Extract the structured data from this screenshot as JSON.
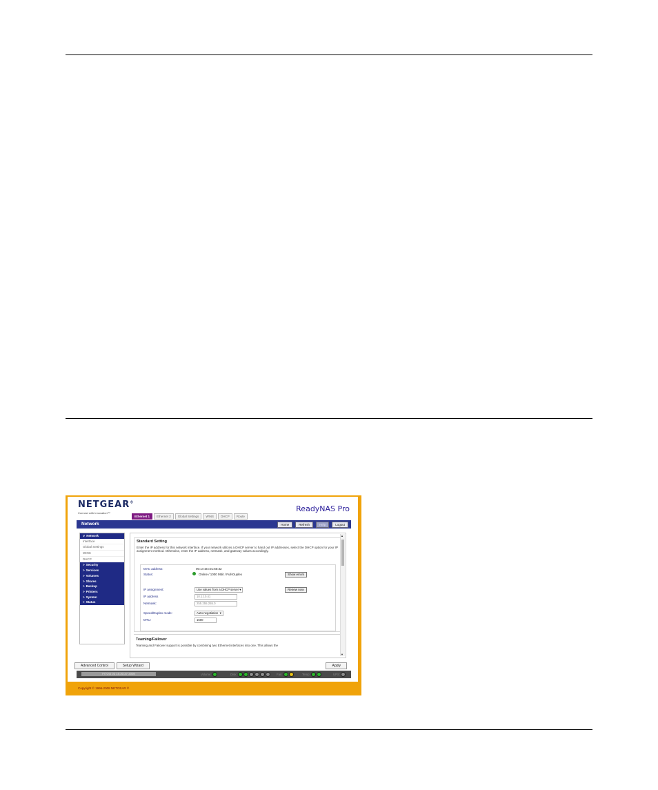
{
  "brand": {
    "logo": "NETGEAR",
    "reg": "®",
    "tagline": "Connect with Innovation™",
    "product": "ReadyNAS Pro",
    "accent": "#2b3791",
    "frame": "#f0a30a"
  },
  "tabs": [
    "Ethernet 1",
    "Ethernet 2",
    "Global Settings",
    "WINS",
    "DHCP",
    "Route"
  ],
  "header": {
    "section": "Network",
    "buttons": [
      "Home",
      "Refresh",
      "Help",
      "Logout"
    ]
  },
  "sidebar": [
    {
      "label": "Network",
      "kind": "head",
      "caret": "∨"
    },
    {
      "label": "Interface",
      "kind": "sub"
    },
    {
      "label": "Global Settings",
      "kind": "sub"
    },
    {
      "label": "WINS",
      "kind": "sub"
    },
    {
      "label": "DHCP",
      "kind": "sub"
    },
    {
      "label": "Security",
      "kind": "head",
      "caret": ">"
    },
    {
      "label": "Services",
      "kind": "head",
      "caret": ">"
    },
    {
      "label": "Volumes",
      "kind": "head",
      "caret": ">"
    },
    {
      "label": "Shares",
      "kind": "head",
      "caret": ">"
    },
    {
      "label": "Backup",
      "kind": "head",
      "caret": ">"
    },
    {
      "label": "Printers",
      "kind": "head",
      "caret": ">"
    },
    {
      "label": "System",
      "kind": "head",
      "caret": ">"
    },
    {
      "label": "Status",
      "kind": "head",
      "caret": ">"
    }
  ],
  "standard": {
    "title": "Standard Setting",
    "description": "Enter the IP address for this network interface. If your network utilizes a DHCP server to hand out IP addresses, select the DHCP option for your IP assignment method. Otherwise, enter the IP address, netmask, and gateway values accordingly.",
    "mac_label": "MAC address:",
    "mac_value": "00:1A:D4:01:60:32",
    "status_label": "Status:",
    "status_value": "Online / 1000 Mbit / Full-Duplex",
    "show_errors": "Show errors",
    "ip_assignment_label": "IP assignment:",
    "ip_assignment_value": "Use values from a DHCP server",
    "renew": "Renew now",
    "ip_label": "IP address",
    "ip_value": "10.1.10.41",
    "netmask_label": "Netmask:",
    "netmask_value": "255.255.255.0",
    "speed_label": "Speed/Duplex mode:",
    "speed_value": "Auto-negotiation",
    "mtu_label": "MTU:",
    "mtu_value": "1500"
  },
  "teaming": {
    "title": "Teaming/Failover",
    "description": "Teaming and Failover support is possible by combining two Ethernet interfaces into one. This allows the"
  },
  "footer": {
    "tabs": [
      "Advanced Control",
      "Setup Wizard"
    ],
    "apply": "Apply",
    "datetime": "Fri Oct 03  15:30:37 2008",
    "status": {
      "volume": "Volume:",
      "disk": "Disk:",
      "fan": "Fan:",
      "temp": "Temp:",
      "ups": "UPS:"
    },
    "copyright": "Copyright © 1996-2008 NETGEAR ®"
  }
}
